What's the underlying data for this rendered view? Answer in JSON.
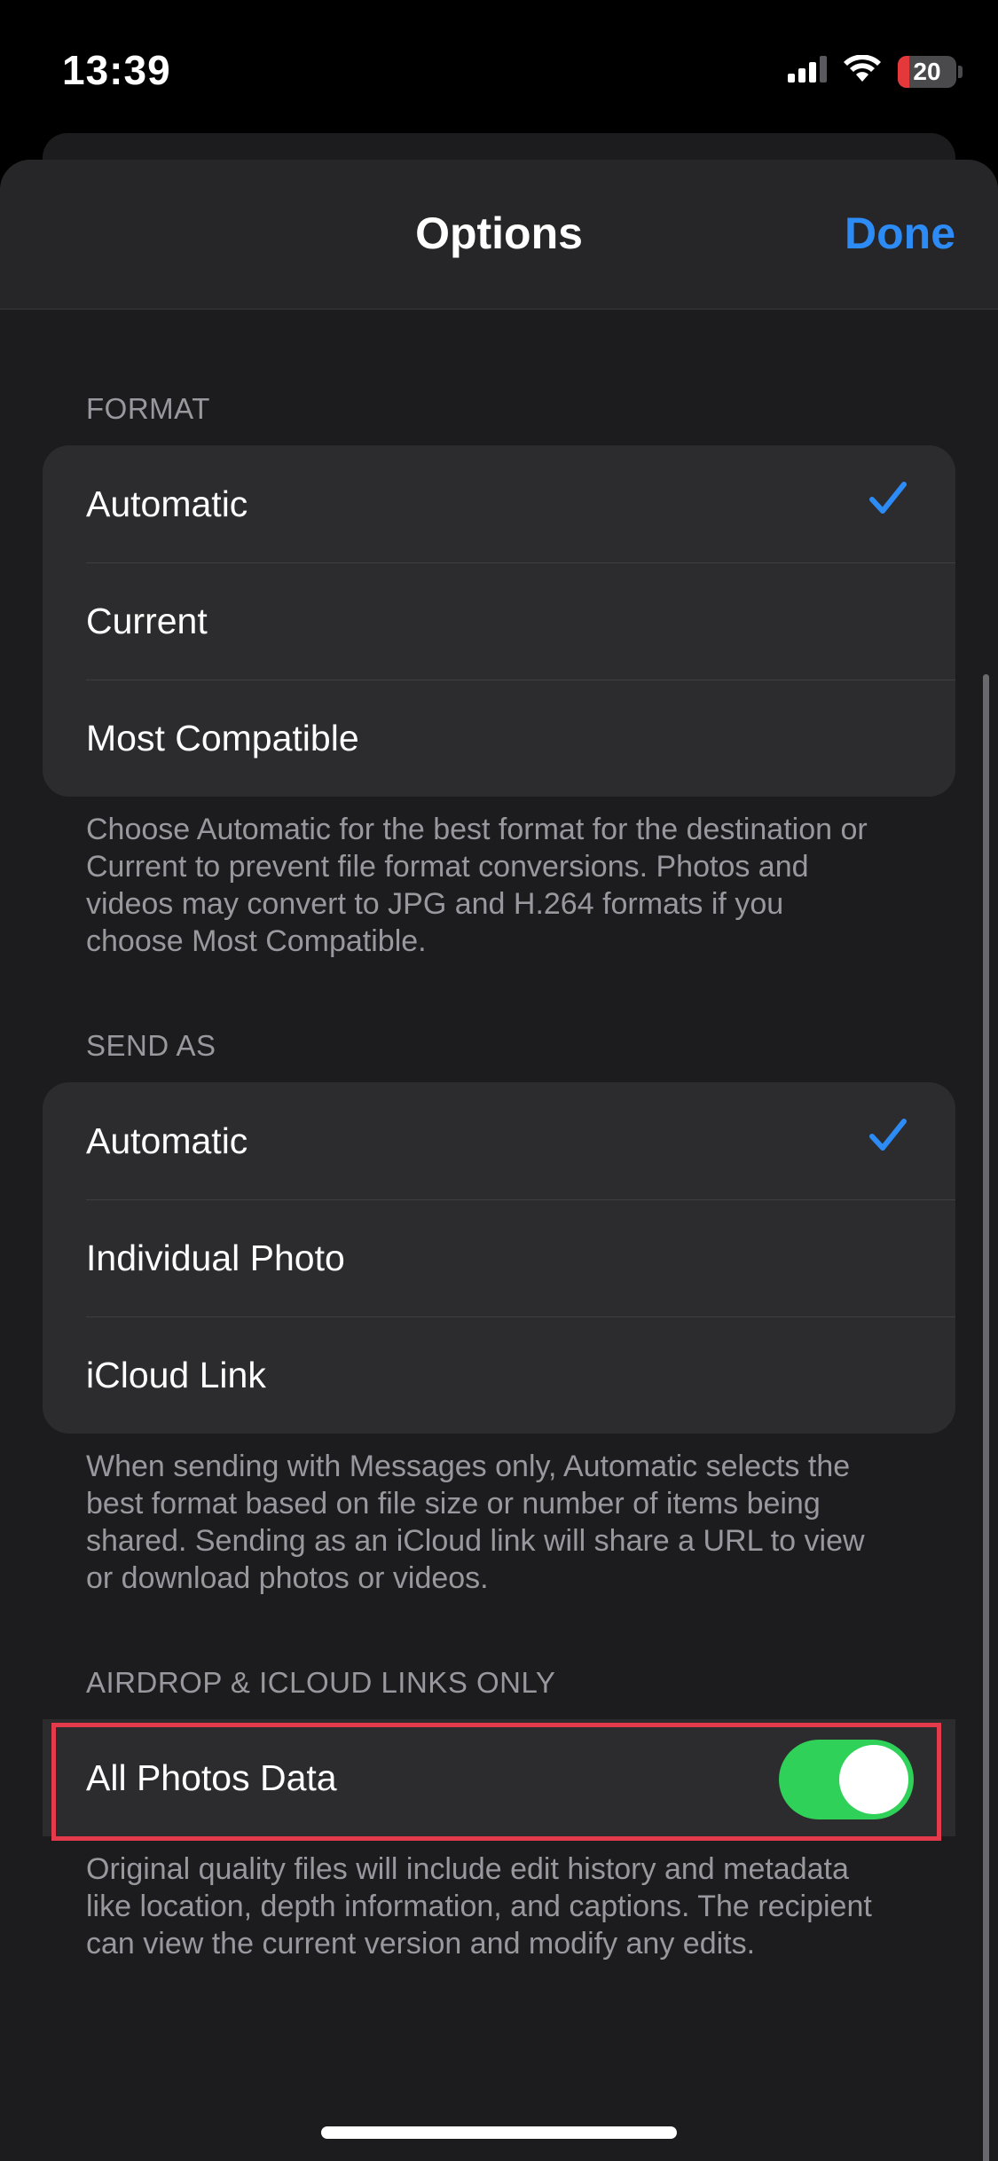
{
  "status_bar": {
    "time": "13:39",
    "battery_level": "20",
    "battery_fraction": 0.2,
    "icons": [
      "cellular-signal-icon",
      "wifi-icon",
      "battery-icon"
    ]
  },
  "sheet": {
    "title": "Options",
    "done_label": "Done"
  },
  "format": {
    "header": "FORMAT",
    "options": [
      {
        "label": "Automatic",
        "selected": true
      },
      {
        "label": "Current",
        "selected": false
      },
      {
        "label": "Most Compatible",
        "selected": false
      }
    ],
    "footnote": "Choose Automatic for the best format for the destination or Current to prevent file format conversions. Photos and videos may convert to JPG and H.264 formats if you choose Most Compatible."
  },
  "send_as": {
    "header": "SEND AS",
    "options": [
      {
        "label": "Automatic",
        "selected": true
      },
      {
        "label": "Individual Photo",
        "selected": false
      },
      {
        "label": "iCloud Link",
        "selected": false
      }
    ],
    "footnote": "When sending with Messages only, Automatic selects the best format based on file size or number of items being shared. Sending as an iCloud link will share a URL to view or download photos or videos."
  },
  "airdrop": {
    "header": "AIRDROP & ICLOUD LINKS ONLY",
    "toggle_label": "All Photos Data",
    "toggle_on": true,
    "footnote": "Original quality files will include edit history and metadata like location, depth information, and captions. The recipient can view the current version and modify any edits."
  },
  "colors": {
    "accent": "#2d8bf5",
    "toggle_on": "#30d158",
    "highlight": "#e43a4b",
    "sheet_bg": "#1c1c1e",
    "group_bg": "#2c2c2e"
  }
}
